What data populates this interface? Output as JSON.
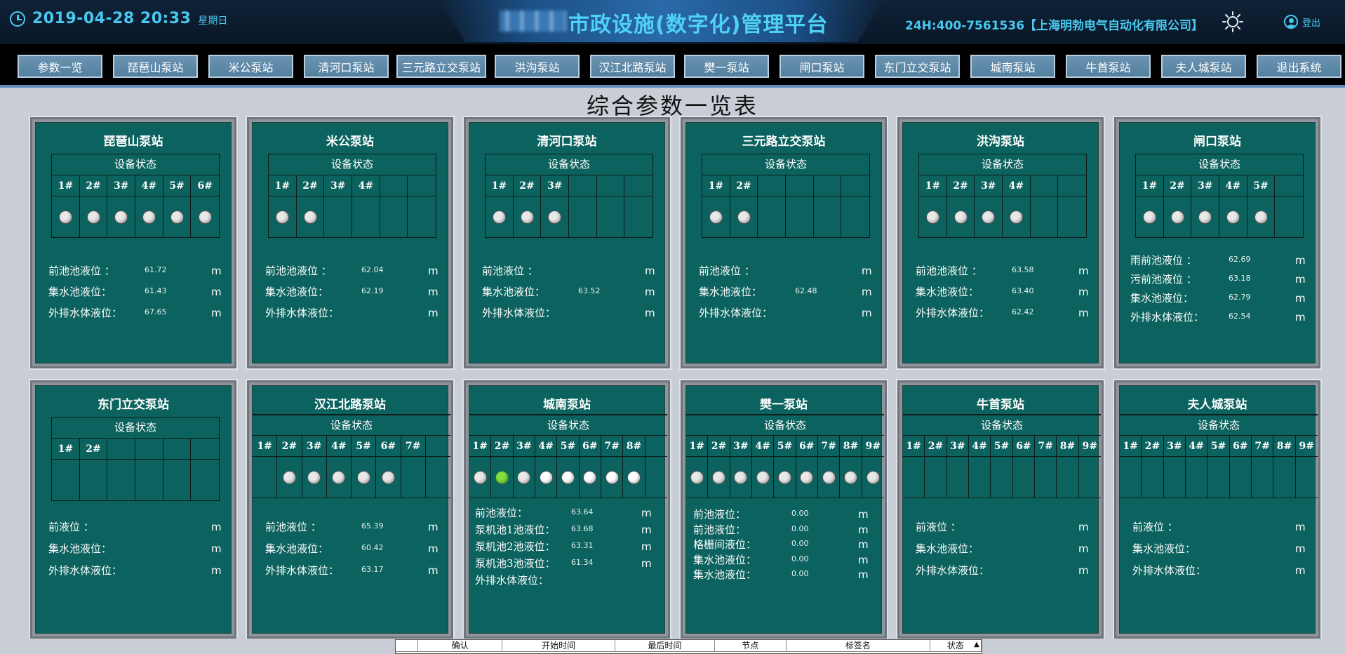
{
  "header": {
    "datetime": "2019-04-28 20:33",
    "weekday": "星期日",
    "title": "市政设施(数字化)管理平台",
    "hotline": "24H:400-7561536【上海明勃电气自动化有限公司】",
    "logout": "登出"
  },
  "nav": [
    "参数一览",
    "琵琶山泵站",
    "米公泵站",
    "清河口泵站",
    "三元路立交泵站",
    "洪沟泵站",
    "汉江北路泵站",
    "樊一泵站",
    "闸口泵站",
    "东门立交泵站",
    "城南泵站",
    "牛首泵站",
    "夫人城泵站",
    "退出系统"
  ],
  "page_title": "综合参数一览表",
  "device_status": "设备状态",
  "stations": [
    {
      "name": "琵琶山泵站",
      "pumps": [
        "1#",
        "2#",
        "3#",
        "4#",
        "5#",
        "6#"
      ],
      "lamps": [
        "off",
        "off",
        "off",
        "off",
        "off",
        "off"
      ],
      "params": [
        {
          "label": "前池池液位 ：",
          "value": "61.72",
          "unit": "m"
        },
        {
          "label": "集水池液位：",
          "value": "61.43",
          "unit": "m"
        },
        {
          "label": "外排水体液位：",
          "value": "67.65",
          "unit": "m"
        }
      ]
    },
    {
      "name": "米公泵站",
      "pumps": [
        "1#",
        "2#",
        "3#",
        "4#",
        "",
        ""
      ],
      "lamps": [
        "off",
        "off",
        "",
        "",
        "",
        ""
      ],
      "params": [
        {
          "label": "前池池液位 ：",
          "value": "62.04",
          "unit": "m"
        },
        {
          "label": "集水池液位：",
          "value": "62.19",
          "unit": "m"
        },
        {
          "label": "外排水体液位：",
          "value": "",
          "unit": "m"
        }
      ]
    },
    {
      "name": "清河口泵站",
      "pumps": [
        "1#",
        "2#",
        "3#",
        "",
        "",
        ""
      ],
      "lamps": [
        "off",
        "off",
        "off",
        "",
        "",
        ""
      ],
      "params": [
        {
          "label": "前池液位 ：",
          "value": "",
          "unit": "m"
        },
        {
          "label": "集水池液位：",
          "value": "63.52",
          "unit": "m"
        },
        {
          "label": "外排水体液位：",
          "value": "",
          "unit": "m"
        }
      ]
    },
    {
      "name": "三元路立交泵站",
      "pumps": [
        "1#",
        "2#",
        "",
        "",
        "",
        ""
      ],
      "lamps": [
        "off",
        "off",
        "",
        "",
        "",
        ""
      ],
      "params": [
        {
          "label": "前池液位 ：",
          "value": "",
          "unit": "m"
        },
        {
          "label": "集水池液位：",
          "value": "62.48",
          "unit": "m"
        },
        {
          "label": "外排水体液位：",
          "value": "",
          "unit": "m"
        }
      ]
    },
    {
      "name": "洪沟泵站",
      "pumps": [
        "1#",
        "2#",
        "3#",
        "4#",
        "",
        ""
      ],
      "lamps": [
        "off",
        "off",
        "off",
        "off",
        "",
        ""
      ],
      "params": [
        {
          "label": "前池池液位 ：",
          "value": "63.58",
          "unit": "m"
        },
        {
          "label": "集水池液位：",
          "value": "63.40",
          "unit": "m"
        },
        {
          "label": "外排水体液位：",
          "value": "62.42",
          "unit": "m"
        }
      ]
    },
    {
      "name": "闸口泵站",
      "pumps": [
        "1#",
        "2#",
        "3#",
        "4#",
        "5#",
        ""
      ],
      "lamps": [
        "off",
        "off",
        "off",
        "off",
        "off",
        ""
      ],
      "params": [
        {
          "label": "雨前池液位 ：",
          "value": "62.69",
          "unit": "m"
        },
        {
          "label": "污前池液位 ：",
          "value": "63.18",
          "unit": "m"
        },
        {
          "label": "集水池液位：",
          "value": "62.79",
          "unit": "m"
        },
        {
          "label": "外排水体液位：",
          "value": "62.54",
          "unit": "m"
        }
      ]
    },
    {
      "name": "东门立交泵站",
      "pumps": [
        "1#",
        "2#",
        "",
        "",
        "",
        ""
      ],
      "lamps": [
        "",
        "",
        "",
        "",
        "",
        ""
      ],
      "params": [
        {
          "label": "前液位 ：",
          "value": "",
          "unit": "m"
        },
        {
          "label": "集水池液位：",
          "value": "",
          "unit": "m"
        },
        {
          "label": "外排水体液位：",
          "value": "",
          "unit": "m"
        }
      ]
    },
    {
      "name": "汉江北路泵站",
      "pumps": [
        "1#",
        "2#",
        "3#",
        "4#",
        "5#",
        "6#",
        "7#",
        ""
      ],
      "lamps": [
        "",
        "off",
        "off",
        "off",
        "off",
        "off",
        "",
        ""
      ],
      "params": [
        {
          "label": "前池液位 ：",
          "value": "65.39",
          "unit": "m"
        },
        {
          "label": "集水池液位：",
          "value": "60.42",
          "unit": "m"
        },
        {
          "label": "外排水体液位：",
          "value": "63.17",
          "unit": "m"
        }
      ]
    },
    {
      "name": "城南泵站",
      "pumps": [
        "1#",
        "2#",
        "3#",
        "4#",
        "5#",
        "6#",
        "7#",
        "8#",
        ""
      ],
      "lamps": [
        "off",
        "on",
        "off",
        "bright",
        "bright",
        "bright",
        "bright",
        "bright",
        ""
      ],
      "params": [
        {
          "label": "前池液位：",
          "value": "63.64",
          "unit": "m"
        },
        {
          "label": "泵机池1池液位：",
          "value": "63.68",
          "unit": "m"
        },
        {
          "label": "泵机池2池液位：",
          "value": "63.31",
          "unit": "m"
        },
        {
          "label": "泵机池3池液位：",
          "value": "61.34",
          "unit": "m"
        },
        {
          "label": "外排水体液位：",
          "value": "",
          "unit": ""
        }
      ]
    },
    {
      "name": "樊一泵站",
      "pumps": [
        "1#",
        "2#",
        "3#",
        "4#",
        "5#",
        "6#",
        "7#",
        "8#",
        "9#"
      ],
      "lamps": [
        "off",
        "off",
        "off",
        "off",
        "off",
        "off",
        "off",
        "off",
        "off"
      ],
      "params": [
        {
          "label": "前池液位：",
          "value": "0.00",
          "unit": "m"
        },
        {
          "label": "前池液位：",
          "value": "0.00",
          "unit": "m"
        },
        {
          "label": "格栅间液位：",
          "value": "0.00",
          "unit": "m"
        },
        {
          "label": "集水池液位：",
          "value": "0.00",
          "unit": "m"
        },
        {
          "label": "集水池液位：",
          "value": "0.00",
          "unit": "m"
        }
      ]
    },
    {
      "name": "牛首泵站",
      "pumps": [
        "1#",
        "2#",
        "3#",
        "4#",
        "5#",
        "6#",
        "7#",
        "8#",
        "9#"
      ],
      "lamps": [
        "",
        "",
        "",
        "",
        "",
        "",
        "",
        "",
        ""
      ],
      "params": [
        {
          "label": "前液位 ：",
          "value": "",
          "unit": "m"
        },
        {
          "label": "集水池液位：",
          "value": "",
          "unit": "m"
        },
        {
          "label": "外排水体液位：",
          "value": "",
          "unit": "m"
        }
      ]
    },
    {
      "name": "夫人城泵站",
      "pumps": [
        "1#",
        "2#",
        "3#",
        "4#",
        "5#",
        "6#",
        "7#",
        "8#",
        "9#"
      ],
      "lamps": [
        "",
        "",
        "",
        "",
        "",
        "",
        "",
        "",
        ""
      ],
      "params": [
        {
          "label": "前液位 ：",
          "value": "",
          "unit": "m"
        },
        {
          "label": "集水池液位：",
          "value": "",
          "unit": "m"
        },
        {
          "label": "外排水体液位：",
          "value": "",
          "unit": "m"
        }
      ]
    }
  ],
  "alarm_table": {
    "columns": [
      "确认",
      "开始时间",
      "最后时间",
      "节点",
      "标签名",
      "状态"
    ]
  },
  "colors": {
    "accent": "#49c9f0",
    "card": "#0b625e",
    "nav": "#5b86a6",
    "lamp_on": "#7fe040"
  }
}
